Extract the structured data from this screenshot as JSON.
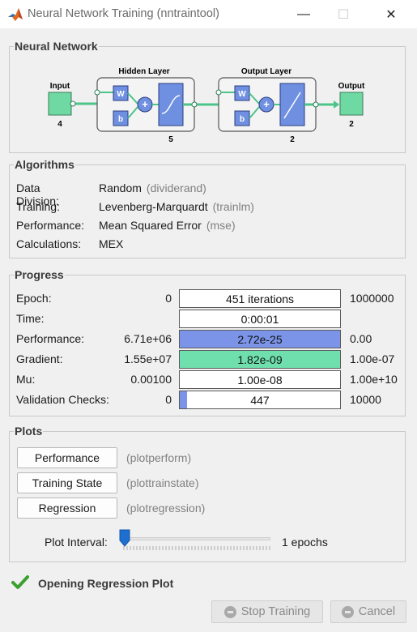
{
  "window": {
    "title": "Neural Network Training (nntraintool)",
    "minimize_glyph": "—",
    "maximize_glyph": "☐",
    "close_glyph": "✕"
  },
  "neural_network": {
    "panel_title": "Neural Network",
    "input_label": "Input",
    "input_size": "4",
    "hidden_label": "Hidden Layer",
    "hidden_size": "5",
    "output_layer_label": "Output Layer",
    "output_layer_size": "2",
    "output_label": "Output",
    "output_size": "2",
    "weight_label": "W",
    "bias_label": "b",
    "colors": {
      "node": "#6fd9a3",
      "block": "#6f8fe0",
      "link": "#4cc48a"
    }
  },
  "algorithms": {
    "panel_title": "Algorithms",
    "rows": [
      {
        "label": "Data Division:",
        "value": "Random",
        "hint": "(dividerand)"
      },
      {
        "label": "Training:",
        "value": "Levenberg-Marquardt",
        "hint": "(trainlm)"
      },
      {
        "label": "Performance:",
        "value": "Mean Squared Error",
        "hint": "(mse)"
      },
      {
        "label": "Calculations:",
        "value": "MEX",
        "hint": ""
      }
    ]
  },
  "progress": {
    "panel_title": "Progress",
    "rows": [
      {
        "label": "Epoch:",
        "min": "0",
        "bar_text": "451 iterations",
        "max": "1000000",
        "fill_fraction": 0,
        "fill_color": "#ffffff"
      },
      {
        "label": "Time:",
        "min": "",
        "bar_text": "0:00:01",
        "max": "",
        "fill_fraction": 0,
        "fill_color": "#ffffff"
      },
      {
        "label": "Performance:",
        "min": "6.71e+06",
        "bar_text": "2.72e-25",
        "max": "0.00",
        "fill_fraction": 1,
        "fill_color": "#7b94e8"
      },
      {
        "label": "Gradient:",
        "min": "1.55e+07",
        "bar_text": "1.82e-09",
        "max": "1.00e-07",
        "fill_fraction": 1,
        "fill_color": "#6fe0ad"
      },
      {
        "label": "Mu:",
        "min": "0.00100",
        "bar_text": "1.00e-08",
        "max": "1.00e+10",
        "fill_fraction": 0,
        "fill_color": "#ffffff"
      },
      {
        "label": "Validation Checks:",
        "min": "0",
        "bar_text": "447",
        "max": "10000",
        "fill_fraction": 0.0447,
        "fill_color": "#7b94e8"
      }
    ]
  },
  "plots": {
    "panel_title": "Plots",
    "buttons": [
      {
        "label": "Performance",
        "hint": "(plotperform)"
      },
      {
        "label": "Training State",
        "hint": "(plottrainstate)"
      },
      {
        "label": "Regression",
        "hint": "(plotregression)"
      }
    ],
    "plot_interval_label": "Plot Interval:",
    "plot_interval_value": "1 epochs",
    "slider_fraction": 0
  },
  "status": {
    "text": "Opening Regression Plot",
    "icon": "checkmark-icon",
    "color": "#3aa030"
  },
  "buttons": {
    "stop_training": "Stop Training",
    "cancel": "Cancel"
  }
}
